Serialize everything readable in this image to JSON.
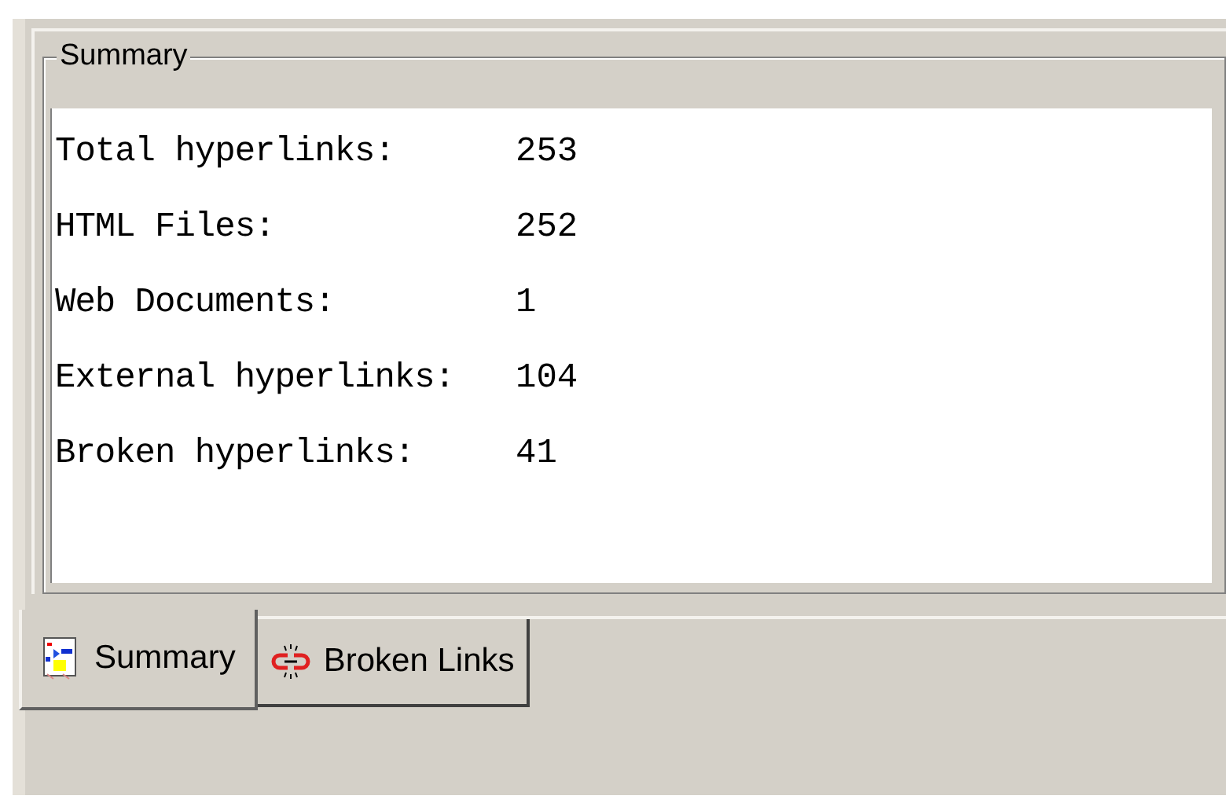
{
  "group": {
    "title": "Summary"
  },
  "rows": [
    {
      "label": "Total hyperlinks:",
      "value": "253"
    },
    {
      "label": "HTML Files:",
      "value": "252"
    },
    {
      "label": "Web Documents:",
      "value": "1"
    },
    {
      "label": "External hyperlinks:",
      "value": "104"
    },
    {
      "label": "Broken hyperlinks:",
      "value": "41"
    }
  ],
  "tabs": [
    {
      "kind": "summary",
      "label": "Summary",
      "selected": true
    },
    {
      "kind": "broken",
      "label": "Broken Links",
      "selected": false
    }
  ]
}
